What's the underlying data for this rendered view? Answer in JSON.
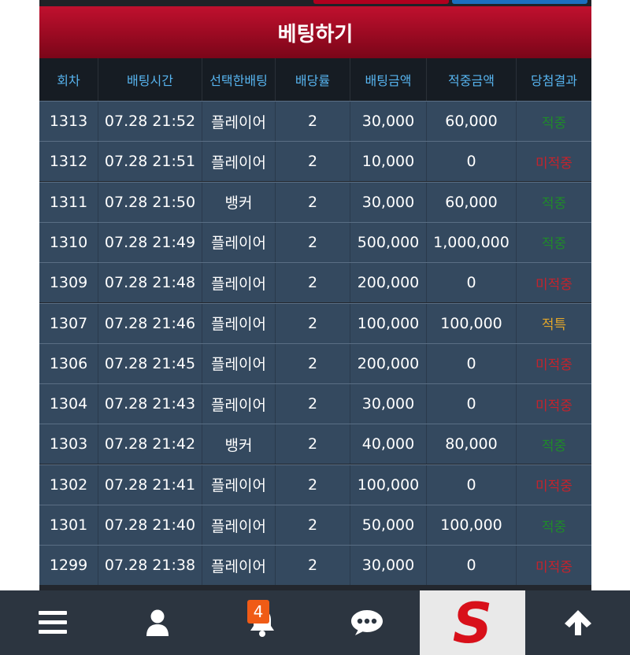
{
  "title": "베팅하기",
  "columns": [
    "회차",
    "배팅시간",
    "선택한배팅",
    "배당률",
    "배팅금액",
    "적중금액",
    "당첨결과"
  ],
  "rows": [
    {
      "round": "1313",
      "time": "07.28 21:52",
      "pick": "플레이어",
      "odds": "2",
      "bet": "30,000",
      "win_amount": "60,000",
      "result": "적중",
      "result_type": "win"
    },
    {
      "round": "1312",
      "time": "07.28 21:51",
      "pick": "플레이어",
      "odds": "2",
      "bet": "10,000",
      "win_amount": "0",
      "result": "미적중",
      "result_type": "lose"
    },
    {
      "round": "1311",
      "time": "07.28 21:50",
      "pick": "뱅커",
      "odds": "2",
      "bet": "30,000",
      "win_amount": "60,000",
      "result": "적중",
      "result_type": "win"
    },
    {
      "round": "1310",
      "time": "07.28 21:49",
      "pick": "플레이어",
      "odds": "2",
      "bet": "500,000",
      "win_amount": "1,000,000",
      "result": "적중",
      "result_type": "win"
    },
    {
      "round": "1309",
      "time": "07.28 21:48",
      "pick": "플레이어",
      "odds": "2",
      "bet": "200,000",
      "win_amount": "0",
      "result": "미적중",
      "result_type": "lose"
    },
    {
      "round": "1307",
      "time": "07.28 21:46",
      "pick": "플레이어",
      "odds": "2",
      "bet": "100,000",
      "win_amount": "100,000",
      "result": "적특",
      "result_type": "hit"
    },
    {
      "round": "1306",
      "time": "07.28 21:45",
      "pick": "플레이어",
      "odds": "2",
      "bet": "200,000",
      "win_amount": "0",
      "result": "미적중",
      "result_type": "lose"
    },
    {
      "round": "1304",
      "time": "07.28 21:43",
      "pick": "플레이어",
      "odds": "2",
      "bet": "30,000",
      "win_amount": "0",
      "result": "미적중",
      "result_type": "lose"
    },
    {
      "round": "1303",
      "time": "07.28 21:42",
      "pick": "뱅커",
      "odds": "2",
      "bet": "40,000",
      "win_amount": "80,000",
      "result": "적중",
      "result_type": "win"
    },
    {
      "round": "1302",
      "time": "07.28 21:41",
      "pick": "플레이어",
      "odds": "2",
      "bet": "100,000",
      "win_amount": "0",
      "result": "미적중",
      "result_type": "lose"
    },
    {
      "round": "1301",
      "time": "07.28 21:40",
      "pick": "플레이어",
      "odds": "2",
      "bet": "50,000",
      "win_amount": "100,000",
      "result": "적중",
      "result_type": "win"
    },
    {
      "round": "1299",
      "time": "07.28 21:38",
      "pick": "플레이어",
      "odds": "2",
      "bet": "30,000",
      "win_amount": "0",
      "result": "미적중",
      "result_type": "lose"
    }
  ],
  "nav": {
    "icons": [
      "menu-icon",
      "user-icon",
      "bell-icon",
      "chat-icon",
      "logo",
      "arrow-up-icon"
    ],
    "notification_count": "4",
    "logo_letter": "S"
  },
  "colors": {
    "title_red": "#9a0a22",
    "header_text": "#57b4ef",
    "row_bg": "#34495f",
    "win": "#1f8a2a",
    "lose": "#c4232c",
    "hit": "#e2a62a",
    "badge": "#f05b16"
  }
}
